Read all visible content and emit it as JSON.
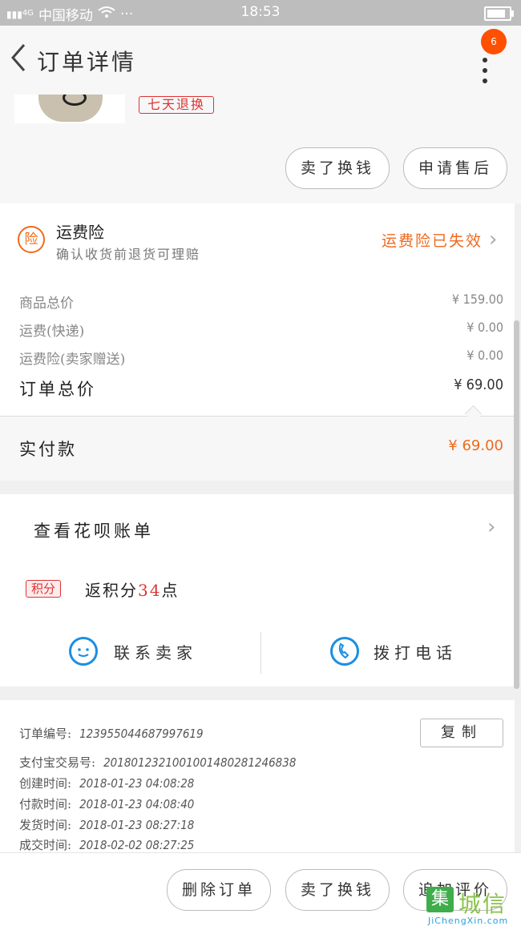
{
  "status_bar": {
    "carrier": "中国移动",
    "signal_label": "4G",
    "time": "18:53",
    "battery_level": 0.85
  },
  "header": {
    "title": "订单详情",
    "badge_count": "6"
  },
  "product": {
    "return_tag": "七天退换",
    "actions": [
      "卖了换钱",
      "申请售后"
    ]
  },
  "insurance": {
    "icon_text": "险",
    "title": "运费险",
    "subtitle": "确认收货前退货可理赔",
    "status": "运费险已失效"
  },
  "price_rows": [
    {
      "label": "商品总价",
      "value": "¥ 159.00"
    },
    {
      "label": "运费(快递)",
      "value": "¥ 0.00"
    },
    {
      "label": "运费险(卖家赠送)",
      "value": "¥ 0.00"
    }
  ],
  "order_total": {
    "label": "订单总价",
    "value": "¥ 69.00"
  },
  "paid": {
    "label": "实付款",
    "value": "¥ 69.00"
  },
  "huabei": {
    "label": "查看花呗账单"
  },
  "points": {
    "tag": "积分",
    "prefix": "返积分",
    "number": "34",
    "suffix": "点"
  },
  "contact": {
    "seller": "联系卖家",
    "phone": "拨打电话"
  },
  "order_info": [
    {
      "label": "订单编号:",
      "value": "123955044687997619"
    },
    {
      "label": "支付宝交易号:",
      "value": "2018012321001001480281246838"
    },
    {
      "label": "创建时间:",
      "value": "2018-01-23 04:08:28"
    },
    {
      "label": "付款时间:",
      "value": "2018-01-23 04:08:40"
    },
    {
      "label": "发货时间:",
      "value": "2018-01-23 08:27:18"
    },
    {
      "label": "成交时间:",
      "value": "2018-02-02 08:27:25"
    }
  ],
  "copy_label": "复制",
  "bottom_actions": [
    "删除订单",
    "卖了换钱",
    "追加评价"
  ],
  "watermark": {
    "mark": "集",
    "text": "城信",
    "url": "JiChengXin.com"
  },
  "colors": {
    "accent": "#f06a1d",
    "red": "#dd3333",
    "blue": "#1a8fe3",
    "badge": "#ff5000"
  }
}
